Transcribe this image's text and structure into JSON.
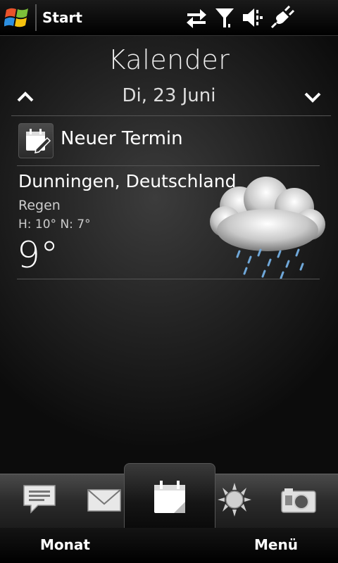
{
  "status_bar": {
    "start_label": "Start",
    "icons": [
      "windows-logo-icon",
      "data-sync-icon",
      "signal-icon",
      "volume-icon",
      "power-plug-icon"
    ]
  },
  "calendar": {
    "title": "Kalender",
    "date": "Di, 23 Juni",
    "new_appointment_label": "Neuer Termin"
  },
  "weather": {
    "location": "Dunningen, Deutschland",
    "condition": "Regen",
    "high_low": "H: 10° N: 7°",
    "temperature": "9°",
    "icon": "rain-cloud-icon"
  },
  "tabs": [
    {
      "icon": "message-icon"
    },
    {
      "icon": "mail-icon"
    },
    {
      "icon": "calendar-icon",
      "active": true
    },
    {
      "icon": "weather-sun-icon"
    },
    {
      "icon": "camera-icon"
    }
  ],
  "softkeys": {
    "left": "Monat",
    "right": "Menü"
  },
  "colors": {
    "background": "#000000",
    "accent_blue": "#6fa7d8"
  }
}
